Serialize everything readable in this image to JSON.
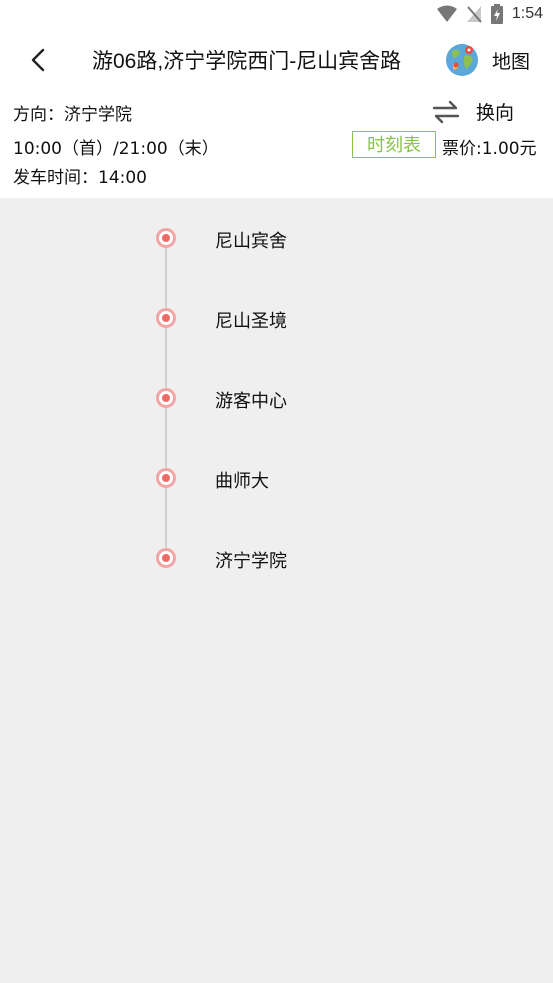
{
  "status": {
    "time": "1:54",
    "icons": [
      "wifi-icon",
      "signal-off-icon",
      "battery-charging-icon"
    ]
  },
  "header": {
    "title": "游06路,济宁学院西门-尼山宾舍路",
    "map_label": "地图"
  },
  "info": {
    "direction": "方向：济宁学院",
    "service_hours": "10:00（首）/21:00（末）",
    "depart_time": "发车时间：14:00",
    "swap_label": "换向",
    "timetable_label": "时刻表",
    "fare": "票价:1.00元"
  },
  "stops": [
    "尼山宾舍",
    "尼山圣境",
    "游客中心",
    "曲师大",
    "济宁学院"
  ],
  "colors": {
    "accent": "#8bc34a",
    "stop_dot": "#ee6a6a",
    "stop_ring": "#f1a5a5",
    "background": "#efefef"
  }
}
